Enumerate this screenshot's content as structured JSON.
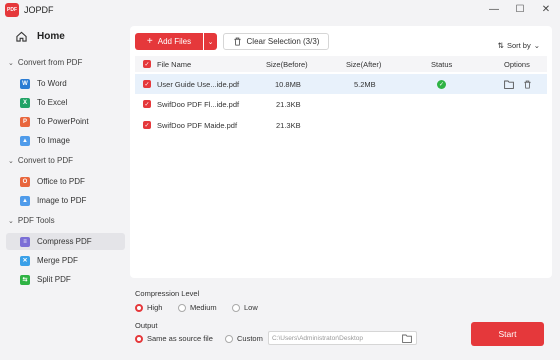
{
  "app": {
    "title": "JOPDF",
    "logo_text": "PDF"
  },
  "window_controls": {
    "minimize": "—",
    "maximize": "☐",
    "close": "✕"
  },
  "sidebar": {
    "home": "Home",
    "sections": [
      {
        "label": "Convert from PDF",
        "items": [
          {
            "label": "To Word",
            "icon": "word-icon",
            "color": "#2b7cd3",
            "glyph": "W"
          },
          {
            "label": "To Excel",
            "icon": "excel-icon",
            "color": "#21a366",
            "glyph": "X"
          },
          {
            "label": "To PowerPoint",
            "icon": "powerpoint-icon",
            "color": "#e8663d",
            "glyph": "P"
          },
          {
            "label": "To Image",
            "icon": "image-icon",
            "color": "#4f9bea",
            "glyph": "▲"
          }
        ]
      },
      {
        "label": "Convert to PDF",
        "items": [
          {
            "label": "Office to PDF",
            "icon": "office-icon",
            "color": "#e8663d",
            "glyph": "O"
          },
          {
            "label": "Image to PDF",
            "icon": "image-to-pdf-icon",
            "color": "#4f9bea",
            "glyph": "▲"
          }
        ]
      },
      {
        "label": "PDF Tools",
        "items": [
          {
            "label": "Compress PDF",
            "icon": "compress-icon",
            "color": "#7b6fd6",
            "glyph": "≡",
            "active": true
          },
          {
            "label": "Merge PDF",
            "icon": "merge-icon",
            "color": "#3aa0e8",
            "glyph": "✕"
          },
          {
            "label": "Split PDF",
            "icon": "split-icon",
            "color": "#2fb344",
            "glyph": "⇆"
          }
        ]
      }
    ]
  },
  "toolbar": {
    "add_files": "Add Files",
    "add_plus": "+",
    "clear": "Clear Selection (3/3)",
    "sort_by": "Sort by"
  },
  "table": {
    "headers": {
      "name": "File Name",
      "before": "Size(Before)",
      "after": "Size(After)",
      "status": "Status",
      "options": "Options"
    },
    "rows": [
      {
        "name": "User Guide Use...ide.pdf",
        "before": "10.8MB",
        "after": "5.2MB",
        "status": "done",
        "selected": true
      },
      {
        "name": "SwifDoo PDF Fl...ide.pdf",
        "before": "21.3KB",
        "after": "",
        "status": "",
        "selected": false
      },
      {
        "name": "SwifDoo PDF Maide.pdf",
        "before": "21.3KB",
        "after": "",
        "status": "",
        "selected": false
      }
    ]
  },
  "compression": {
    "label": "Compression Level",
    "options": [
      "High",
      "Medium",
      "Low"
    ],
    "selected": "High"
  },
  "output": {
    "label": "Output",
    "same_as_source": "Same as source file",
    "custom": "Custom",
    "path": "C:\\Users\\Administrator\\Desktop",
    "selected": "same"
  },
  "start_label": "Start",
  "colors": {
    "accent": "#e5383b",
    "selected_row": "#e8f1fb",
    "success": "#2fb344"
  }
}
